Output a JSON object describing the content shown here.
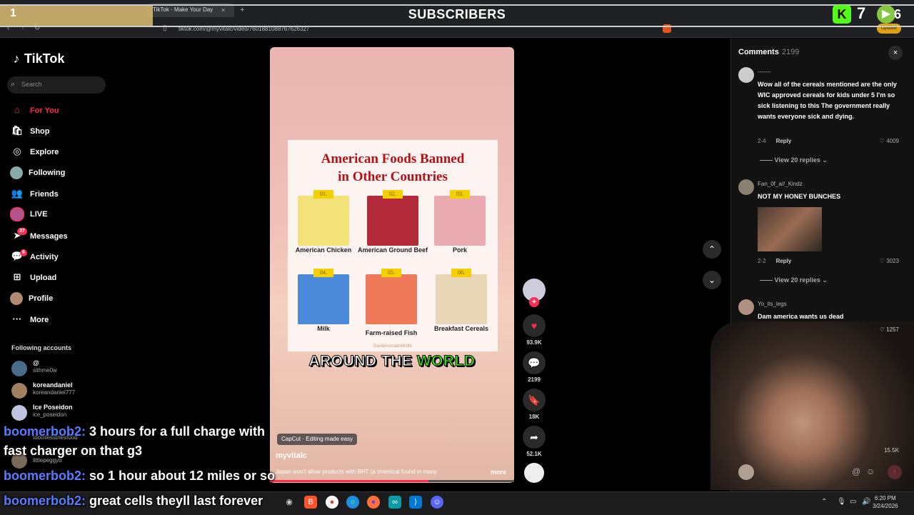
{
  "browser": {
    "tab_title": "TikTok - Make Your Day",
    "tab_close": "×",
    "new_tab": "+",
    "url": "tiktok.com/@myvitalc/video/7601881088767626327",
    "update_label": "Update"
  },
  "overlay": {
    "subscriber_count": "1",
    "title": "SUBSCRIBERS",
    "kick_count": "7",
    "rumble_count": "6"
  },
  "sidebar": {
    "logo": "TikTok",
    "search_placeholder": "Search",
    "items": [
      {
        "label": "For You",
        "icon": "⌂"
      },
      {
        "label": "Shop",
        "icon": "🛍"
      },
      {
        "label": "Explore",
        "icon": "◎"
      },
      {
        "label": "Following",
        "icon": ""
      },
      {
        "label": "Friends",
        "icon": "👥"
      },
      {
        "label": "LIVE",
        "icon": ""
      },
      {
        "label": "Messages",
        "icon": "➤",
        "badge": "37"
      },
      {
        "label": "Activity",
        "icon": "💬",
        "badge": "6"
      },
      {
        "label": "Upload",
        "icon": "⊞"
      },
      {
        "label": "Profile",
        "icon": ""
      },
      {
        "label": "More",
        "icon": "···"
      }
    ],
    "following_header": "Following accounts",
    "accounts": [
      {
        "name": "@",
        "handle": "sithme0w"
      },
      {
        "name": "koreandaniel",
        "handle": "koreandaniel777"
      },
      {
        "name": "Ice Poseidon",
        "handle": "ice_poseidon"
      },
      {
        "name": "",
        "handle": "toothlesstriesfood"
      },
      {
        "name": "",
        "handle": "littlepeggyb"
      }
    ]
  },
  "video": {
    "card_title_line1": "American Foods Banned",
    "card_title_line2": "in Other Countries",
    "foods": [
      {
        "num": "01.",
        "label": "American Chicken"
      },
      {
        "num": "02.",
        "label": "American Ground Beef"
      },
      {
        "num": "03.",
        "label": "Pork"
      },
      {
        "num": "04.",
        "label": "Milk"
      },
      {
        "num": "05.",
        "label": "Farm-raised Fish"
      },
      {
        "num": "06.",
        "label": "Breakfast Cereals"
      }
    ],
    "watermark": "DavidAvocadoWolfe",
    "caption_part1": "AROUND THE ",
    "caption_highlight": "WORLD",
    "capcut": "CapCut · Editing made easy",
    "author": "myvitalc",
    "description": "Japan won't allow products with BHT (a chemical found in many",
    "more": "more",
    "progress": 0.65
  },
  "actions": {
    "likes": "93.9K",
    "comments": "2199",
    "saves": "18K",
    "shares": "52.1K"
  },
  "comments": {
    "title": "Comments",
    "count": "2199",
    "close": "×",
    "items": [
      {
        "user": "-------",
        "text": "Wow all of the cereals mentioned are the only WIC approved cereals for kids under 5 I'm so sick listening to this The government really wants everyone sick and dying.",
        "date": "2-4",
        "reply": "Reply",
        "likes": "4009",
        "replies": "View 20 replies"
      },
      {
        "user": "Fan_0f_a//_Kindz",
        "text": "NOT MY HONEY BUNCHES",
        "date": "2-2",
        "reply": "Reply",
        "likes": "3023",
        "replies": "View 20 replies"
      },
      {
        "user": "Yo_its_legs",
        "text": "Dam america wants us dead",
        "likes": "1257"
      }
    ],
    "extra_likes": "15.5K"
  },
  "chat": [
    {
      "user": "boomerbob2:",
      "msg": " 3 hours for a full charge with"
    },
    {
      "user": "",
      "msg": "fast charger on that g3"
    },
    {
      "user": "boomerbob2:",
      "msg": " so 1 hour about 12 miles or so"
    },
    {
      "user": "boomerbob2:",
      "msg": " great cells theyll last forever"
    }
  ],
  "taskbar": {
    "time": "6:20 PM",
    "date": "3/24/2026"
  },
  "colors": {
    "accent": "#fe2c55",
    "caption_highlight": "#3cf000",
    "card_title": "#b31217",
    "chat_user": "#5a7cff",
    "kick": "#53fc18",
    "rumble": "#85c742"
  }
}
